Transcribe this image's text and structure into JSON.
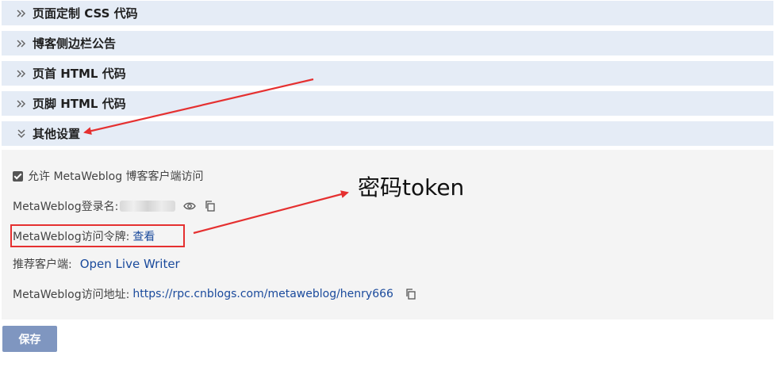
{
  "sections": [
    {
      "label": "页面定制 CSS 代码",
      "expanded": false
    },
    {
      "label": "博客侧边栏公告",
      "expanded": false
    },
    {
      "label": "页首 HTML 代码",
      "expanded": false
    },
    {
      "label": "页脚 HTML 代码",
      "expanded": false
    },
    {
      "label": "其他设置",
      "expanded": true
    }
  ],
  "settings": {
    "allow_metaweblog_label": "允许 MetaWeblog 博客客户端访问",
    "allow_metaweblog_checked": true,
    "login_name_label": "MetaWeblog登录名:",
    "token_label": "MetaWeblog访问令牌:",
    "token_link": "查看",
    "client_label": "推荐客户端:",
    "client_link": "Open Live Writer",
    "url_label": "MetaWeblog访问地址:",
    "url_value": "https://rpc.cnblogs.com/metaweblog/henry666"
  },
  "save_label": "保存",
  "annotation": "密码token",
  "colors": {
    "header_bg": "#e5ecf6",
    "panel_bg": "#f4f4f4",
    "link": "#1a4a9c",
    "annotation_red": "#e53030",
    "save_bg": "#7f96c0"
  }
}
